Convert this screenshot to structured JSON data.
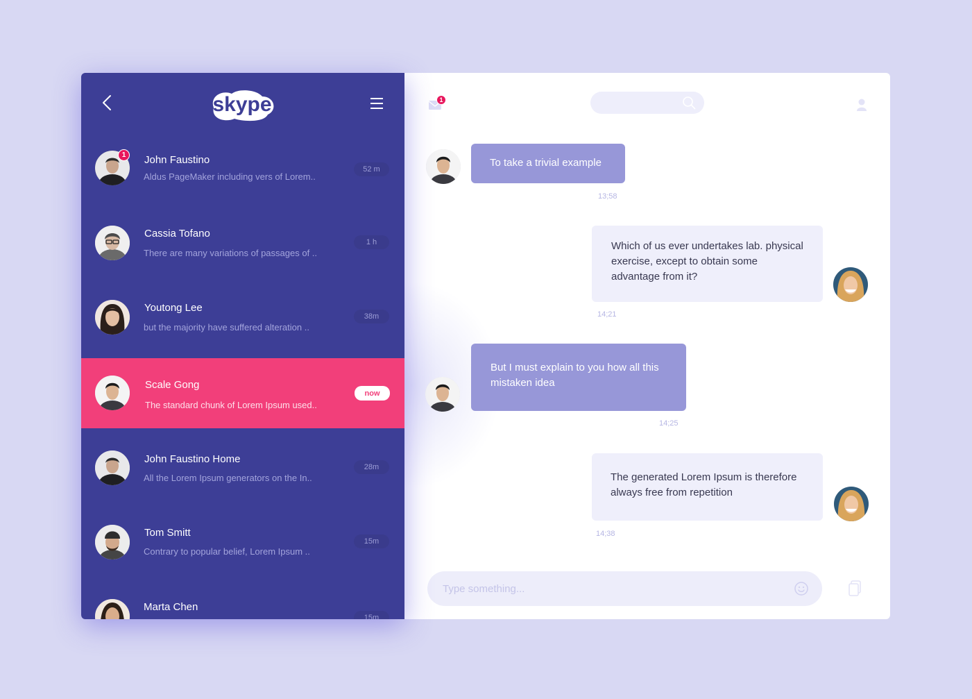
{
  "sidebar": {
    "logo_text": "skype",
    "chats": [
      {
        "name": "John Faustino",
        "preview": "Aldus PageMaker including vers of Lorem..",
        "time": "52 m",
        "badge": "1"
      },
      {
        "name": "Cassia Tofano",
        "preview": "There are many variations of passages of ..",
        "time": "1 h"
      },
      {
        "name": "Youtong Lee",
        "preview": "but the majority have suffered alteration ..",
        "time": "38m"
      },
      {
        "name": "Scale Gong",
        "preview": "The standard chunk of Lorem Ipsum used..",
        "time": "now",
        "active": true
      },
      {
        "name": "John Faustino Home",
        "preview": "All the Lorem Ipsum generators on the In..",
        "time": "28m"
      },
      {
        "name": "Tom Smitt",
        "preview": "Contrary to popular belief, Lorem Ipsum ..",
        "time": "15m"
      },
      {
        "name": "Marta Chen",
        "preview": "",
        "time": "15m"
      }
    ]
  },
  "header": {
    "mail_badge": "1",
    "search_placeholder": ""
  },
  "messages": [
    {
      "direction": "in",
      "text": "To take a trivial example",
      "time": "13;58"
    },
    {
      "direction": "out",
      "text": "Which of us ever undertakes lab. physical exercise, except to obtain some advantage from it?",
      "time": "14;21"
    },
    {
      "direction": "in",
      "text": "But I must explain to you how all this mistaken idea",
      "time": "14;25"
    },
    {
      "direction": "out",
      "text": "The generated Lorem Ipsum is therefore always free from repetition",
      "time": "14;38"
    }
  ],
  "composer": {
    "placeholder": "Type something..."
  },
  "colors": {
    "sidebar_bg": "#3d3e96",
    "active_chat": "#f23f7a",
    "incoming_bubble": "#9797d8",
    "outgoing_bubble": "#efeffb",
    "badge": "#e8175d",
    "page_bg": "#d8d8f3"
  }
}
